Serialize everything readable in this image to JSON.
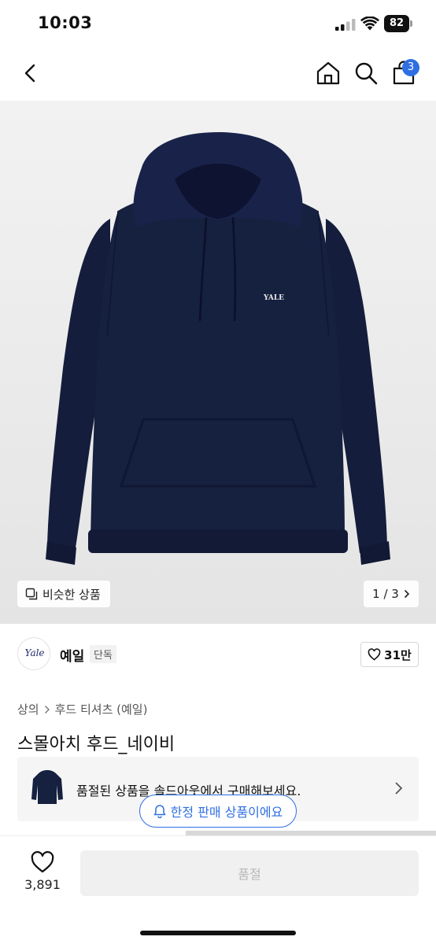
{
  "status_bar": {
    "time": "10:03",
    "battery": "82"
  },
  "nav": {
    "cart_count": "3",
    "icons": [
      "back-icon",
      "home-icon",
      "search-icon",
      "cart-icon"
    ]
  },
  "hero": {
    "similar_label": "비슷한 상품",
    "page_indicator": "1 / 3",
    "hoodie_color": "#152041",
    "logo_text": "YALE"
  },
  "brand": {
    "logo_text": "Yale",
    "name": "예일",
    "tag": "단독",
    "likes": "31만"
  },
  "breadcrumb": {
    "items": [
      "상의",
      "후드 티셔츠 (예일)"
    ]
  },
  "product": {
    "title": "스몰아치 후드_네이비"
  },
  "soldout_banner": {
    "text": "품절된 상품을 솔드아웃에서 구매해보세요."
  },
  "limited_pill": {
    "text": "한정 판매 상품이에요"
  },
  "bottom_bar": {
    "wish_count": "3,891",
    "buy_label": "품절"
  },
  "colors": {
    "accent": "#2f6fe4",
    "hoodie": "#152041"
  }
}
